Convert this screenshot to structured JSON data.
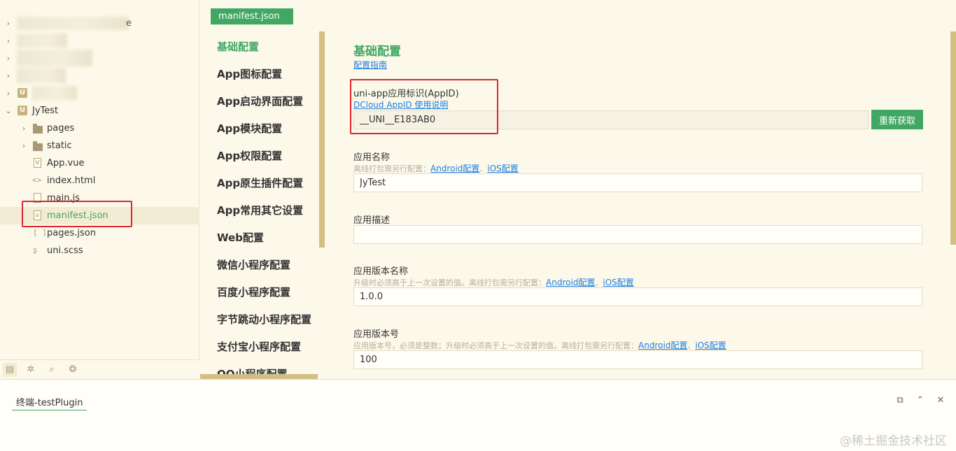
{
  "tree": {
    "project": "JyTest",
    "items": [
      {
        "label": "pages",
        "type": "folder"
      },
      {
        "label": "static",
        "type": "folder"
      },
      {
        "label": "App.vue",
        "type": "vue"
      },
      {
        "label": "index.html",
        "type": "html"
      },
      {
        "label": "main.js",
        "type": "js"
      },
      {
        "label": "manifest.json",
        "type": "json",
        "selected": true
      },
      {
        "label": "pages.json",
        "type": "json"
      },
      {
        "label": "uni.scss",
        "type": "scss"
      }
    ],
    "partial_label": "e"
  },
  "editor_tab": "manifest.json",
  "nav": [
    "基础配置",
    "App图标配置",
    "App启动界面配置",
    "App模块配置",
    "App权限配置",
    "App原生插件配置",
    "App常用其它设置",
    "Web配置",
    "微信小程序配置",
    "百度小程序配置",
    "字节跳动小程序配置",
    "支付宝小程序配置",
    "QQ小程序配置"
  ],
  "form": {
    "title": "基础配置",
    "guide_link": "配置指南",
    "appid": {
      "label": "uni-app应用标识(AppID)",
      "link": "DCloud AppID 使用说明",
      "value": "__UNI__E183AB0",
      "button": "重新获取"
    },
    "app_name": {
      "label": "应用名称",
      "hint": "离线打包需另行配置：",
      "link_android": "Android配置",
      "sep": "、",
      "link_ios": "iOS配置",
      "value": "JyTest"
    },
    "app_desc": {
      "label": "应用描述",
      "value": ""
    },
    "version_name": {
      "label": "应用版本名称",
      "hint": "升级时必须高于上一次设置的值。离线打包需另行配置：",
      "link_android": "Android配置",
      "sep": "、",
      "link_ios": "iOS配置",
      "value": "1.0.0"
    },
    "version_code": {
      "label": "应用版本号",
      "hint": "应用版本号，必须是整数；升级时必须高于上一次设置的值。离线打包需另行配置：",
      "link_android": "Android配置",
      "sep": "、",
      "link_ios": "iOS配置",
      "value": "100"
    }
  },
  "terminal": {
    "tab": "终端-testPlugin"
  },
  "watermark": "@稀土掘金技术社区",
  "colors": {
    "accent": "#41a863",
    "background": "#fcf9ea",
    "link": "#1f7ee0",
    "highlight_border": "#e0252e",
    "scrollbar": "#d3bf82"
  }
}
